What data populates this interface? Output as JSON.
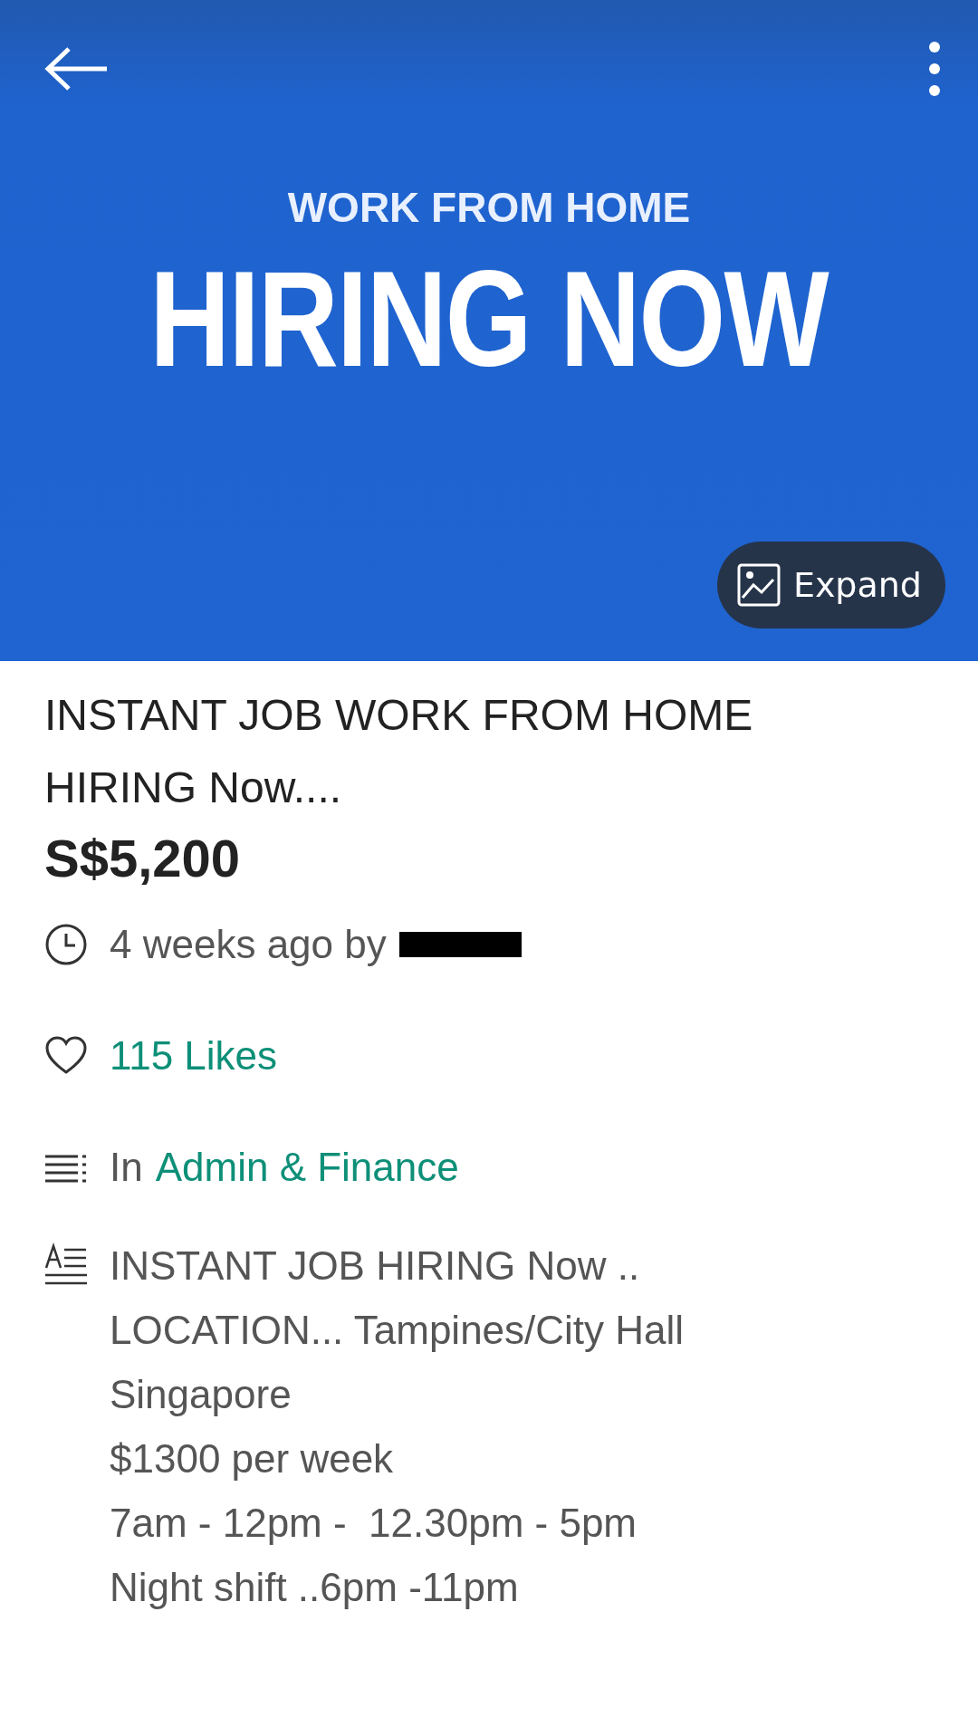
{
  "banner": {
    "subtitle": "WORK FROM HOME",
    "headline": "HIRING NOW",
    "expand_button": "Expand"
  },
  "listing": {
    "title": "INSTANT JOB WORK FROM HOME HIRING Now....",
    "price": "S$5,200"
  },
  "meta": [
    {
      "kind": "posted",
      "text": "4 weeks ago by",
      "redacted": true
    },
    {
      "kind": "likes",
      "link": "115 Likes"
    },
    {
      "kind": "category",
      "text": "In",
      "link": "Admin & Finance"
    }
  ],
  "description": [
    "INSTANT JOB HIRING Now ..",
    "LOCATION... Tampines/City Hall",
    "Singapore",
    "$1300 per week",
    "7am - 12pm -  12.30pm - 5pm",
    "Night shift ..6pm -11pm"
  ]
}
